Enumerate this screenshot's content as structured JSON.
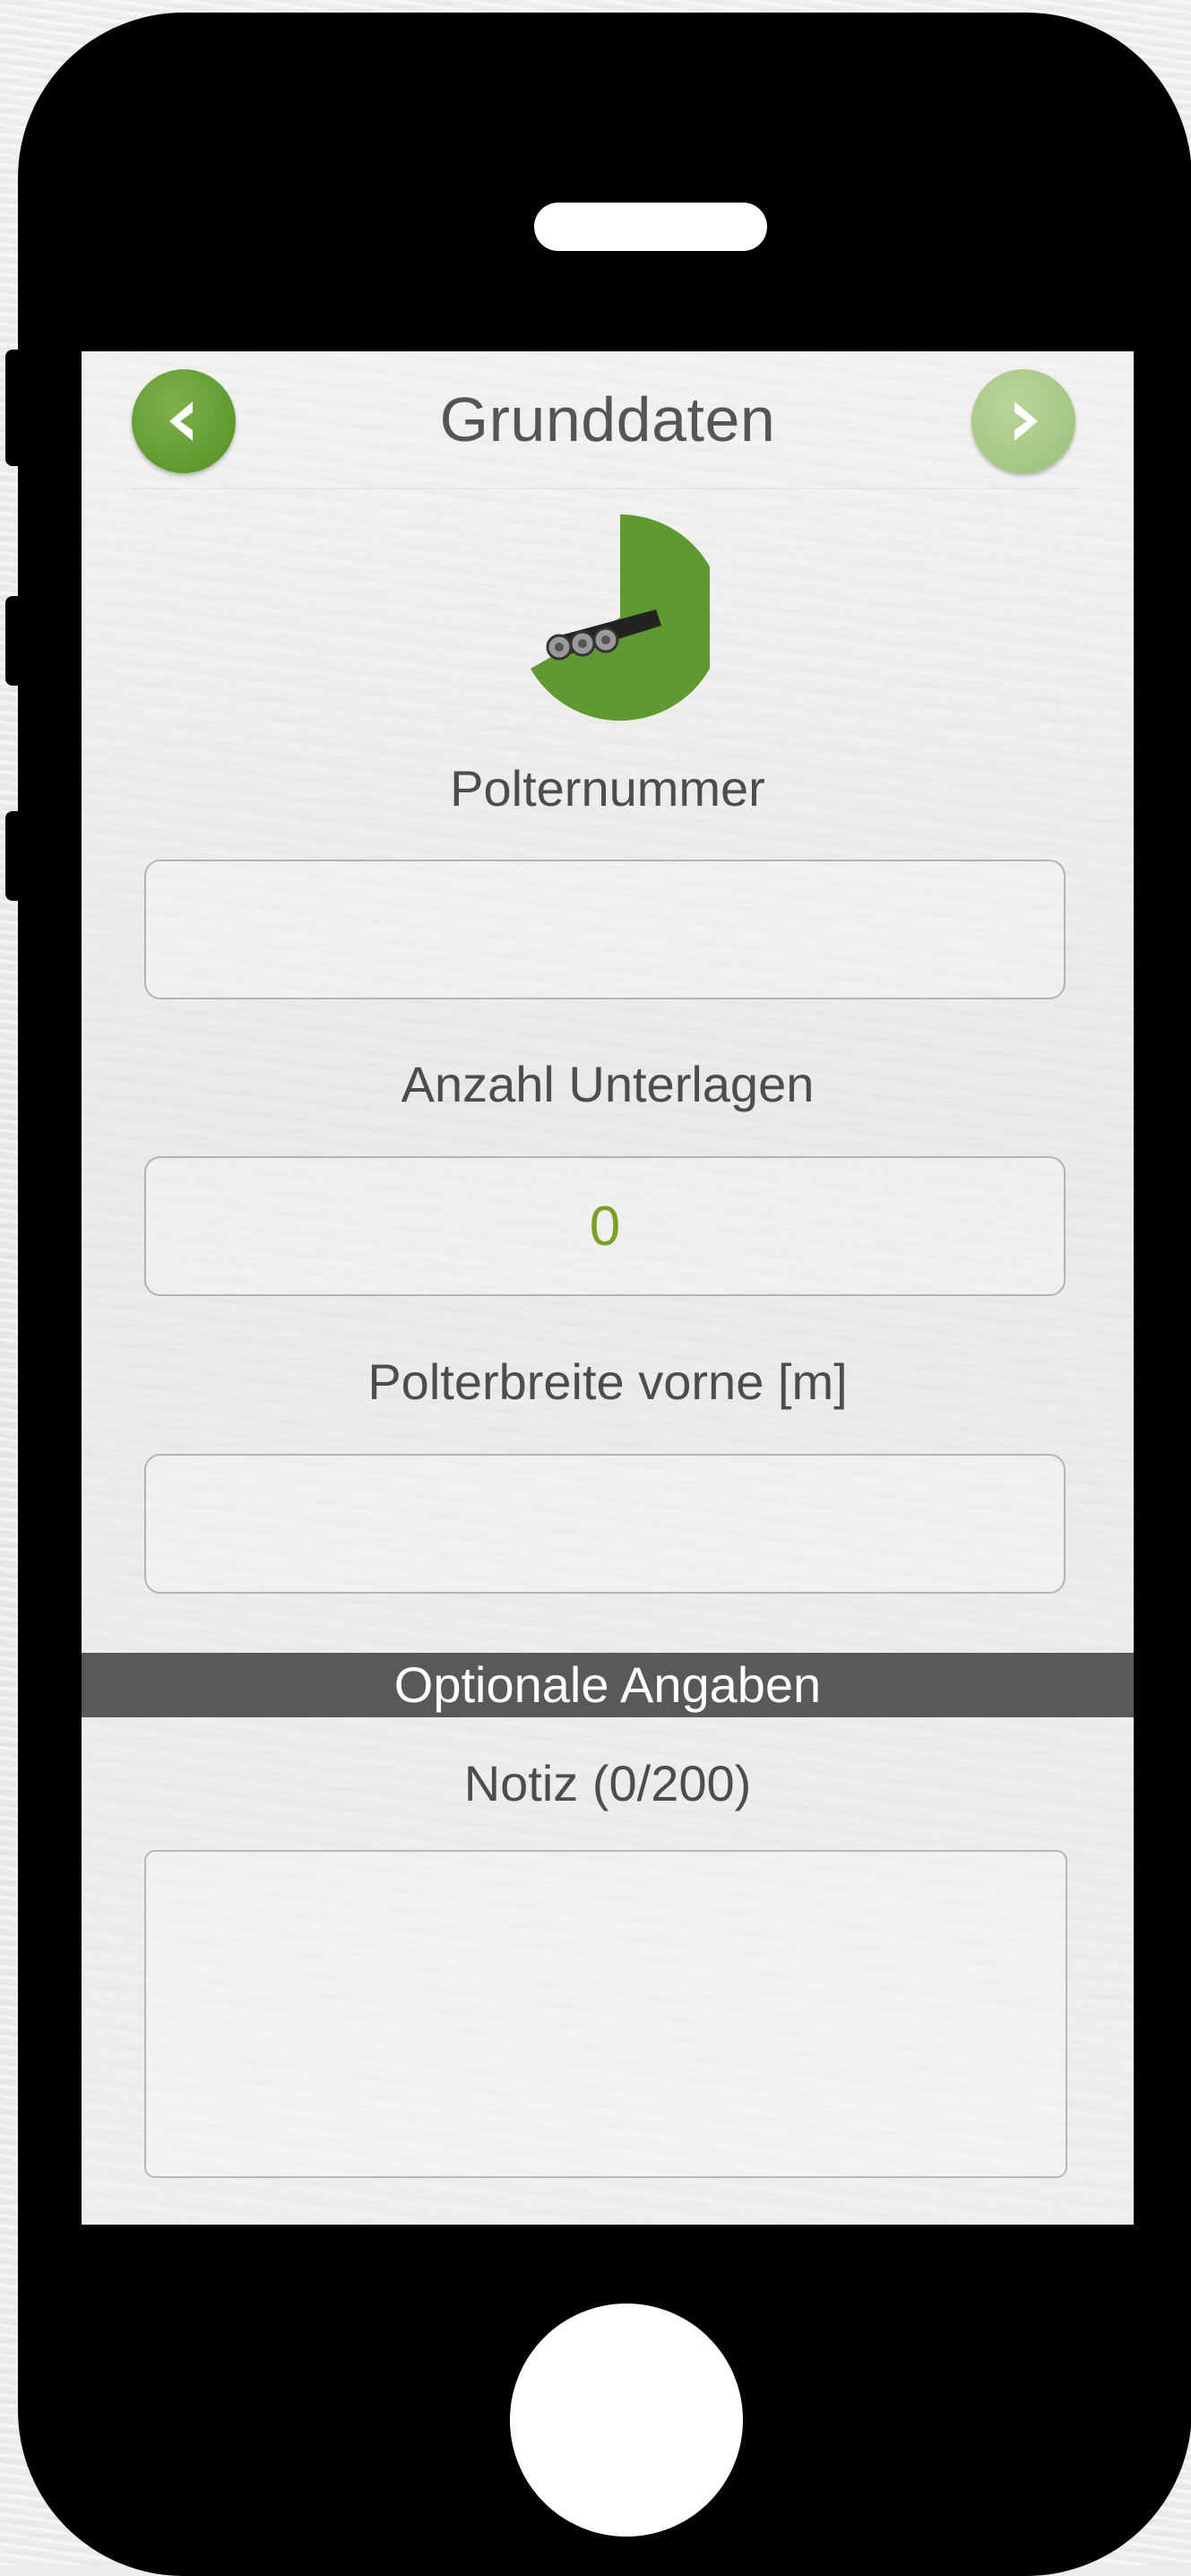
{
  "header": {
    "title": "Grunddaten",
    "back_icon": "chevron-left-icon",
    "forward_icon": "chevron-right-icon"
  },
  "progress": {
    "icon": "log-pile-icon",
    "fraction": 0.5
  },
  "fields": {
    "polternummer": {
      "label": "Polternummer",
      "value": ""
    },
    "anzahl_unterlagen": {
      "label": "Anzahl Unterlagen",
      "value": "0"
    },
    "polterbreite": {
      "label": "Polterbreite vorne [m]",
      "value": ""
    }
  },
  "optional": {
    "section_title": "Optionale Angaben",
    "note_label": "Notiz (0/200)",
    "note_value": ""
  },
  "colors": {
    "accent_green": "#5e9a2f",
    "accent_green_light": "#a3c782",
    "value_green": "#7aa024",
    "section_bar": "#595959",
    "phone_body": "#000000"
  }
}
